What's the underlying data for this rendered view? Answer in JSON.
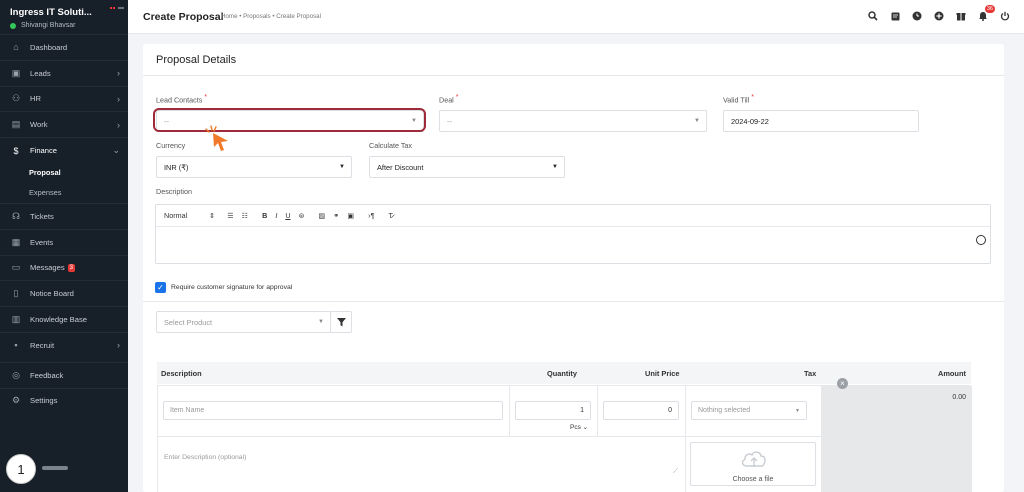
{
  "sidebar": {
    "company_name": "Ingress IT Soluti...",
    "user_name": "Shivangi Bhavsar",
    "items": [
      {
        "label": "Dashboard",
        "icon": "dashboard-icon"
      },
      {
        "label": "Leads",
        "icon": "leads-icon"
      },
      {
        "label": "HR",
        "icon": "hr-icon"
      },
      {
        "label": "Work",
        "icon": "work-icon"
      },
      {
        "label": "Finance",
        "icon": "finance-icon"
      },
      {
        "label": "Proposal"
      },
      {
        "label": "Expenses"
      },
      {
        "label": "Tickets",
        "icon": "tickets-icon"
      },
      {
        "label": "Events",
        "icon": "events-icon"
      },
      {
        "label": "Messages",
        "icon": "messages-icon",
        "badge": "3"
      },
      {
        "label": "Notice Board",
        "icon": "notice-board-icon"
      },
      {
        "label": "Knowledge Base",
        "icon": "knowledge-base-icon"
      },
      {
        "label": "Recruit",
        "icon": "recruit-icon"
      },
      {
        "label": "Feedback",
        "icon": "feedback-icon"
      },
      {
        "label": "Settings",
        "icon": "settings-icon"
      }
    ],
    "step_badge": "1"
  },
  "header": {
    "title": "Create Proposal",
    "breadcrumb": "Home • Proposals • Create Proposal",
    "notification_count": "36"
  },
  "form": {
    "heading": "Proposal Details",
    "lead_contacts_label": "Lead Contacts",
    "lead_contacts_value": "--",
    "deal_label": "Deal",
    "deal_value": "--",
    "valid_till_label": "Valid Till",
    "valid_till_value": "2024-09-22",
    "currency_label": "Currency",
    "currency_value": "INR (₹)",
    "calculate_tax_label": "Calculate Tax",
    "calculate_tax_value": "After Discount",
    "description_label": "Description",
    "editor_format": "Normal",
    "signature_label": "Require customer signature for approval",
    "required_mark": "*"
  },
  "product": {
    "placeholder": "Select Product"
  },
  "table": {
    "headers": {
      "description": "Description",
      "quantity": "Quantity",
      "unit_price": "Unit Price",
      "tax": "Tax",
      "amount": "Amount"
    },
    "row": {
      "item_name_placeholder": "Item Name",
      "quantity": "1",
      "unit": "Pcs",
      "unit_price": "0",
      "tax": "Nothing selected",
      "amount": "0.00",
      "description_placeholder": "Enter Description (optional)",
      "choose_file": "Choose a file"
    }
  },
  "colors": {
    "sidebar_bg": "#171f29",
    "highlight_ring": "#9e2a3a",
    "cursor": "#f07a2a",
    "checkbox": "#1a73e8"
  }
}
